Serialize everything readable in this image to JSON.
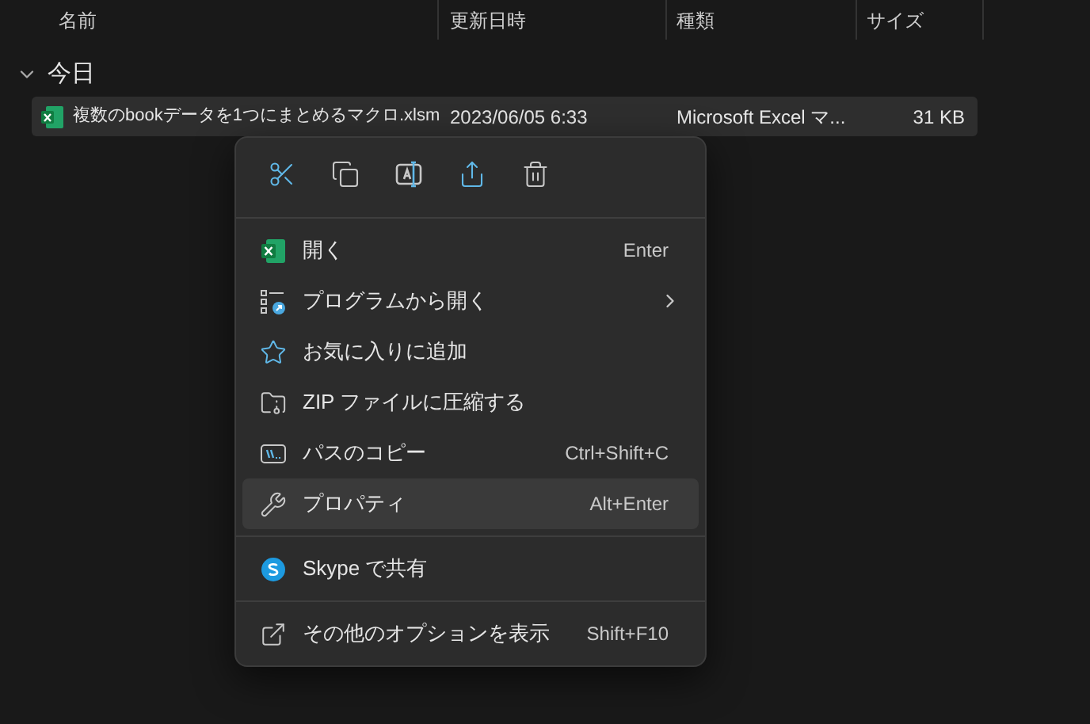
{
  "columns": [
    {
      "label": "名前"
    },
    {
      "label": "更新日時"
    },
    {
      "label": "種類"
    },
    {
      "label": "サイズ"
    }
  ],
  "groups": [
    {
      "label": "今日",
      "expanded": true,
      "files": [
        {
          "name": "複数のbookデータを1つにまとめるマクロ.xlsm",
          "modified": "2023/06/05 6:33",
          "type": "Microsoft Excel マ...",
          "size": "31 KB",
          "selected": true
        }
      ]
    }
  ],
  "context_menu": {
    "toolbar": [
      {
        "kind": "cut"
      },
      {
        "kind": "copy"
      },
      {
        "kind": "rename"
      },
      {
        "kind": "share"
      },
      {
        "kind": "delete"
      }
    ],
    "sections": [
      [
        {
          "kind": "excel",
          "label": "開く",
          "shortcut": "Enter",
          "submenu": false,
          "selected": false
        },
        {
          "kind": "openwith",
          "label": "プログラムから開く",
          "submenu": true,
          "selected": false
        },
        {
          "kind": "star",
          "label": "お気に入りに追加",
          "submenu": false,
          "selected": false
        },
        {
          "kind": "zip",
          "label": "ZIP ファイルに圧縮する",
          "submenu": false,
          "selected": false
        },
        {
          "kind": "path",
          "label": "パスのコピー",
          "shortcut": "Ctrl+Shift+C",
          "submenu": false,
          "selected": false
        },
        {
          "kind": "wrench",
          "label": "プロパティ",
          "shortcut": "Alt+Enter",
          "submenu": false,
          "selected": true
        }
      ],
      [
        {
          "kind": "skype",
          "label": "Skype で共有",
          "submenu": false,
          "selected": false
        }
      ],
      [
        {
          "kind": "more",
          "label": "その他のオプションを表示",
          "shortcut": "Shift+F10",
          "submenu": false,
          "selected": false
        }
      ]
    ]
  }
}
